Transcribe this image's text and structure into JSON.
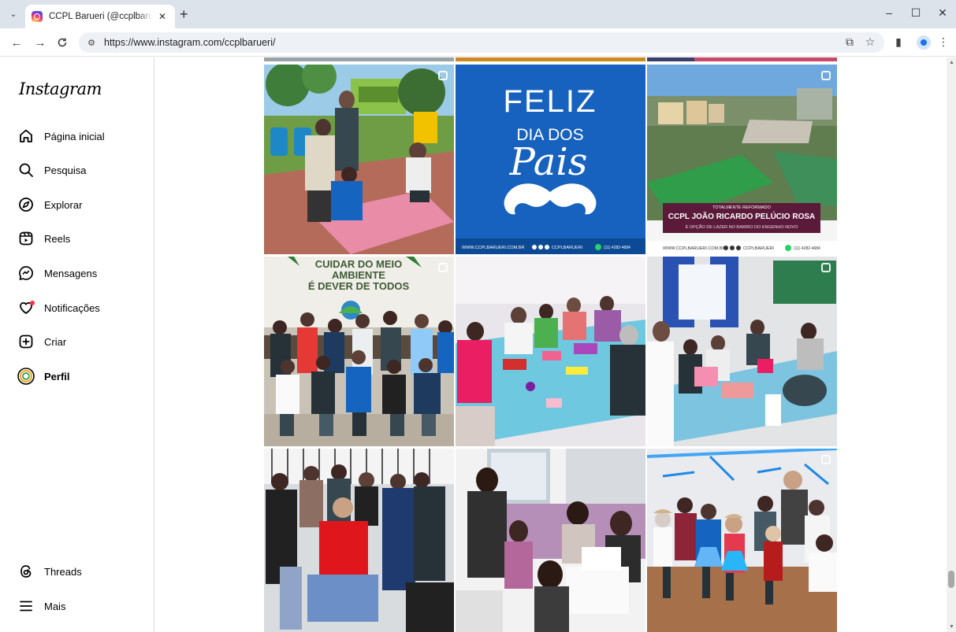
{
  "browser": {
    "tab_title": "CCPL Barueri (@ccplbarueri) • Instagram photos and videos",
    "url": "https://www.instagram.com/ccplbarueri/",
    "new_tab": "+",
    "close_tab": "✕",
    "minimize": "–",
    "maximize": "☐",
    "close_window": "✕"
  },
  "sidebar": {
    "logo": "Instagram",
    "items": [
      {
        "label": "Página inicial",
        "icon": "home-icon"
      },
      {
        "label": "Pesquisa",
        "icon": "search-icon"
      },
      {
        "label": "Explorar",
        "icon": "compass-icon"
      },
      {
        "label": "Reels",
        "icon": "reels-icon"
      },
      {
        "label": "Mensagens",
        "icon": "messenger-icon"
      },
      {
        "label": "Notificações",
        "icon": "heart-icon"
      },
      {
        "label": "Criar",
        "icon": "plus-square-icon"
      },
      {
        "label": "Perfil",
        "icon": "avatar"
      }
    ],
    "bottom_items": [
      {
        "label": "Threads",
        "icon": "threads-icon"
      },
      {
        "label": "Mais",
        "icon": "menu-icon"
      }
    ]
  },
  "posts": {
    "feliz": {
      "line1": "FELIZ",
      "line2": "DIA DOS",
      "line3": "Pais",
      "footer_site": "WWW.CCPLBARUERI.COM.BR",
      "footer_handle": "CCPLBARUERI",
      "footer_phone": "(11) 4282-4684"
    },
    "field": {
      "banner_top": "TOTALMENTE REFORMADO",
      "banner_title": "CCPL JOÃO RICARDO PELÚCIO ROSA",
      "banner_sub": "É OPÇÃO DE LAZER NO BAIRRO DO ENGENHO NOVO",
      "footer_site": "WWW.CCPLBARUERI.COM.BR",
      "footer_handle": "CCPLBARUERI",
      "footer_phone": "(11) 4282-4684"
    },
    "mural": {
      "line1": "CUIDAR DO MEIO",
      "line2": "AMBIENTE",
      "line3": "É DEVER DE TODOS"
    }
  },
  "colors": {
    "feliz_bg": "#1565c0",
    "banner": "#5b1a3a",
    "instagram_red": "#ff3040"
  }
}
